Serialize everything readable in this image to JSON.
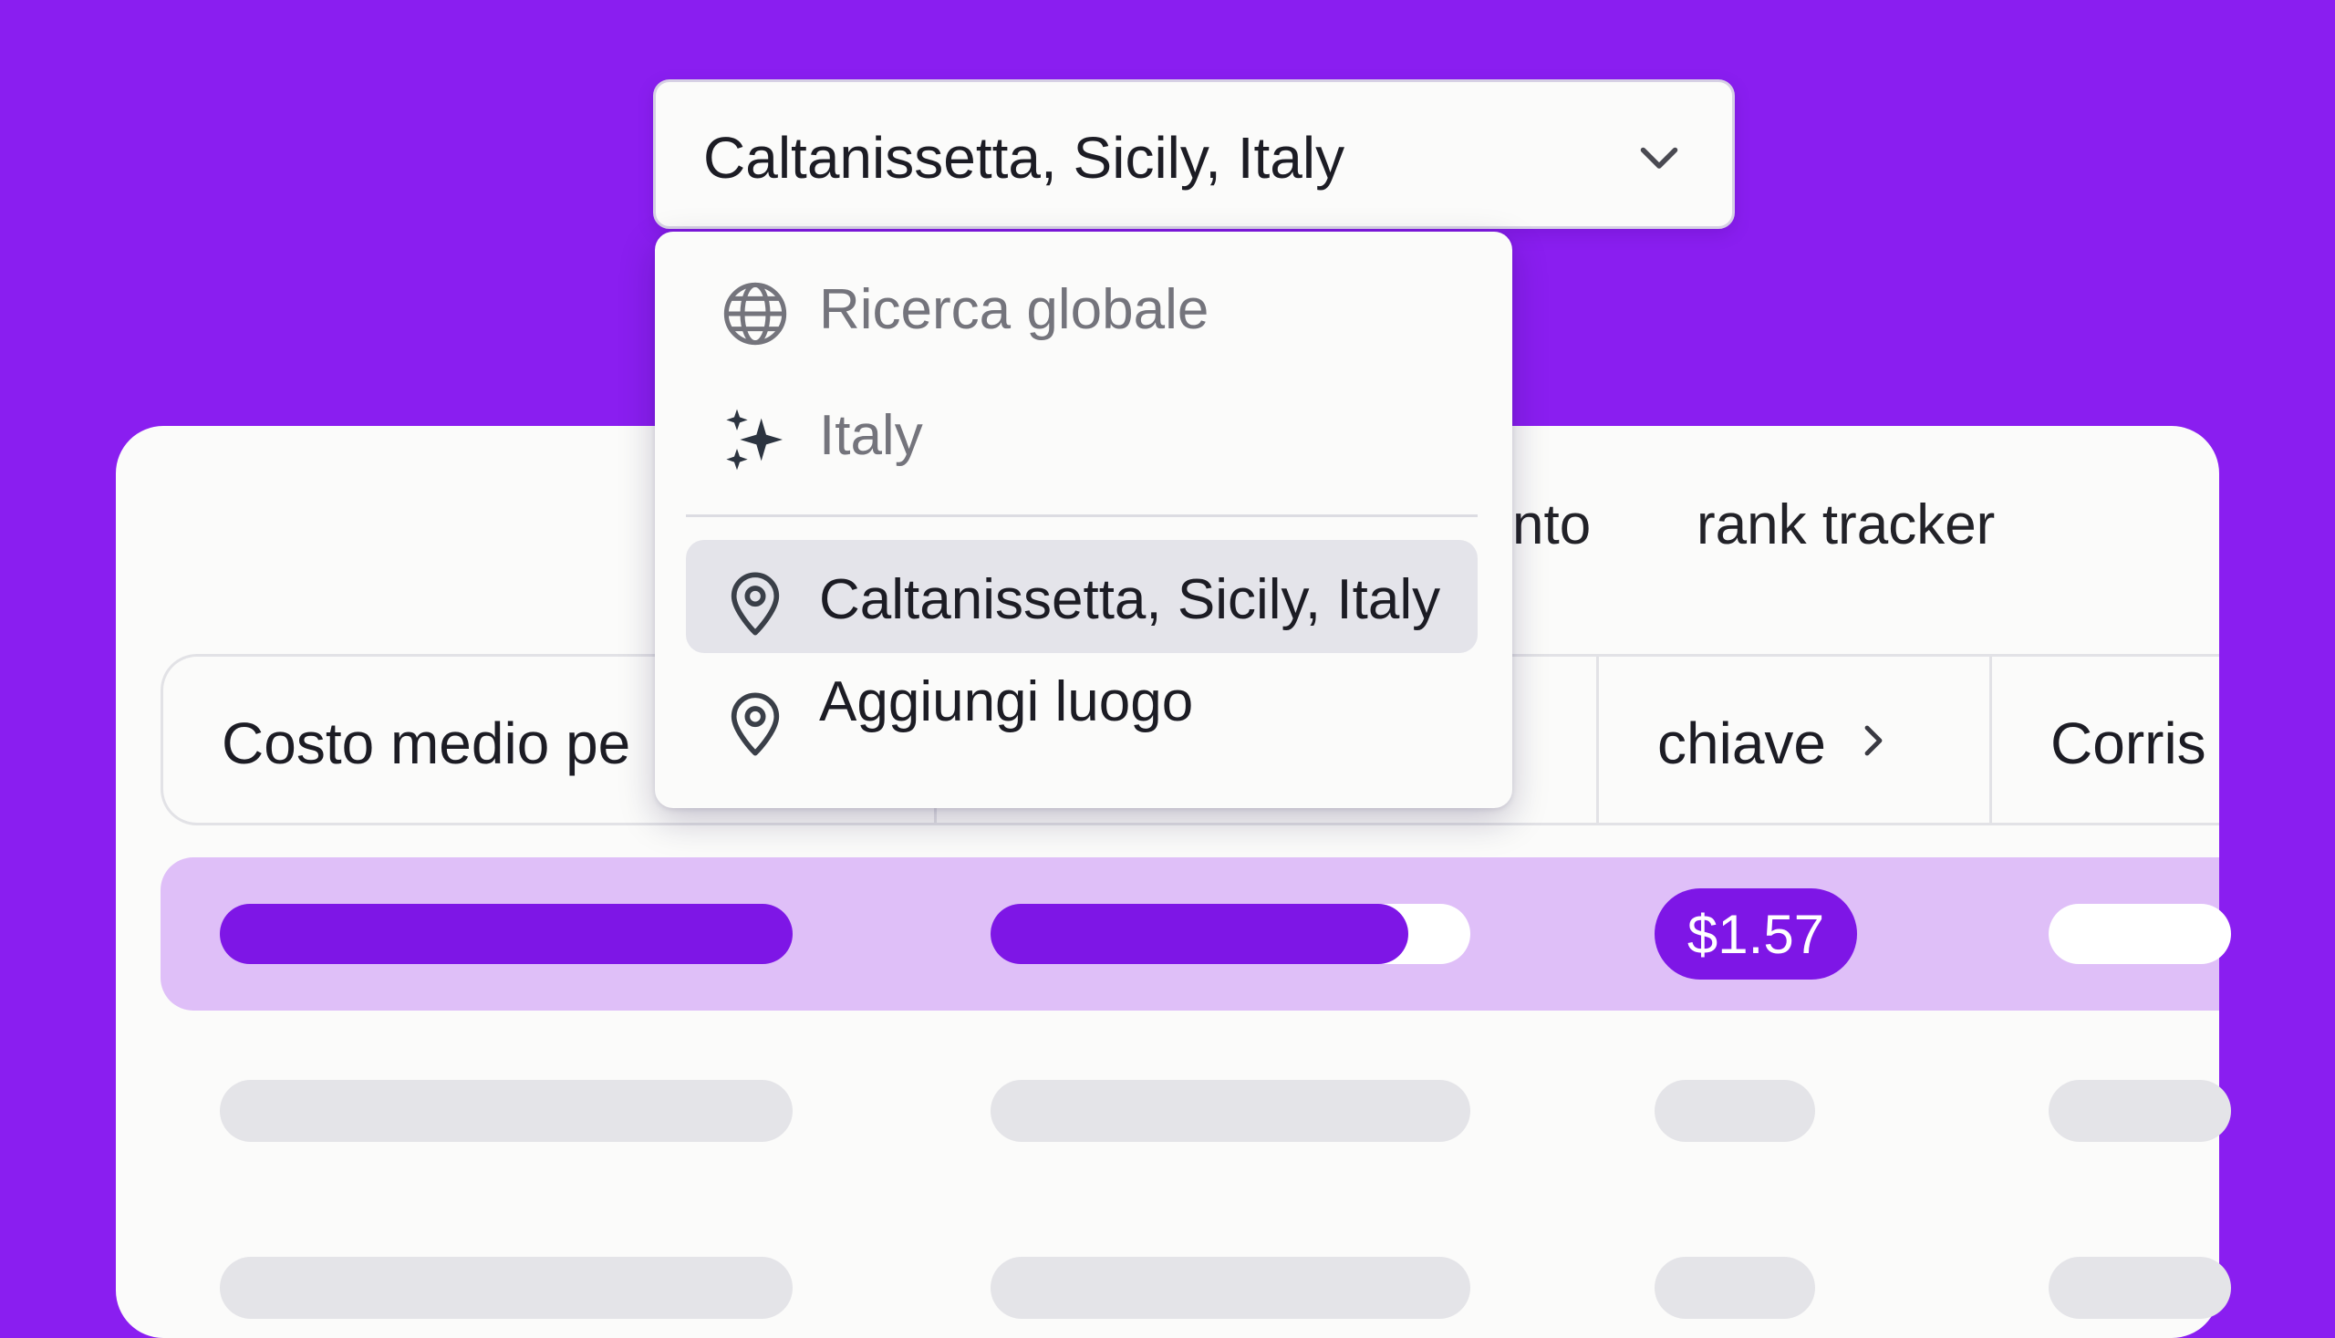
{
  "location_select": {
    "value": "Caltanissetta, Sicily, Italy",
    "chevron_icon": "chevron-down-icon"
  },
  "location_menu": {
    "items": [
      {
        "label": "Ricerca globale",
        "icon": "globe-icon",
        "muted": true
      },
      {
        "label": "Italy",
        "icon": "sparkles-icon",
        "muted": true
      },
      {
        "label": "Caltanissetta, Sicily, Italy",
        "icon": "map-pin-icon",
        "selected": true
      },
      {
        "label": "Aggiungi luogo",
        "icon": "map-pin-icon"
      }
    ]
  },
  "tabs": {
    "partial_tab_label": "nto",
    "rank_tracker_label": "rank tracker"
  },
  "table": {
    "headers": {
      "col1": "Costo medio pe",
      "col3": "chiave",
      "col4": "Corris"
    },
    "highlighted_row": {
      "price": "$1.57",
      "bar2_fill_fraction": 0.87
    }
  },
  "colors": {
    "background": "#8a1ef0",
    "accent": "#7e16e6",
    "highlight_row": "#dfbff8"
  }
}
